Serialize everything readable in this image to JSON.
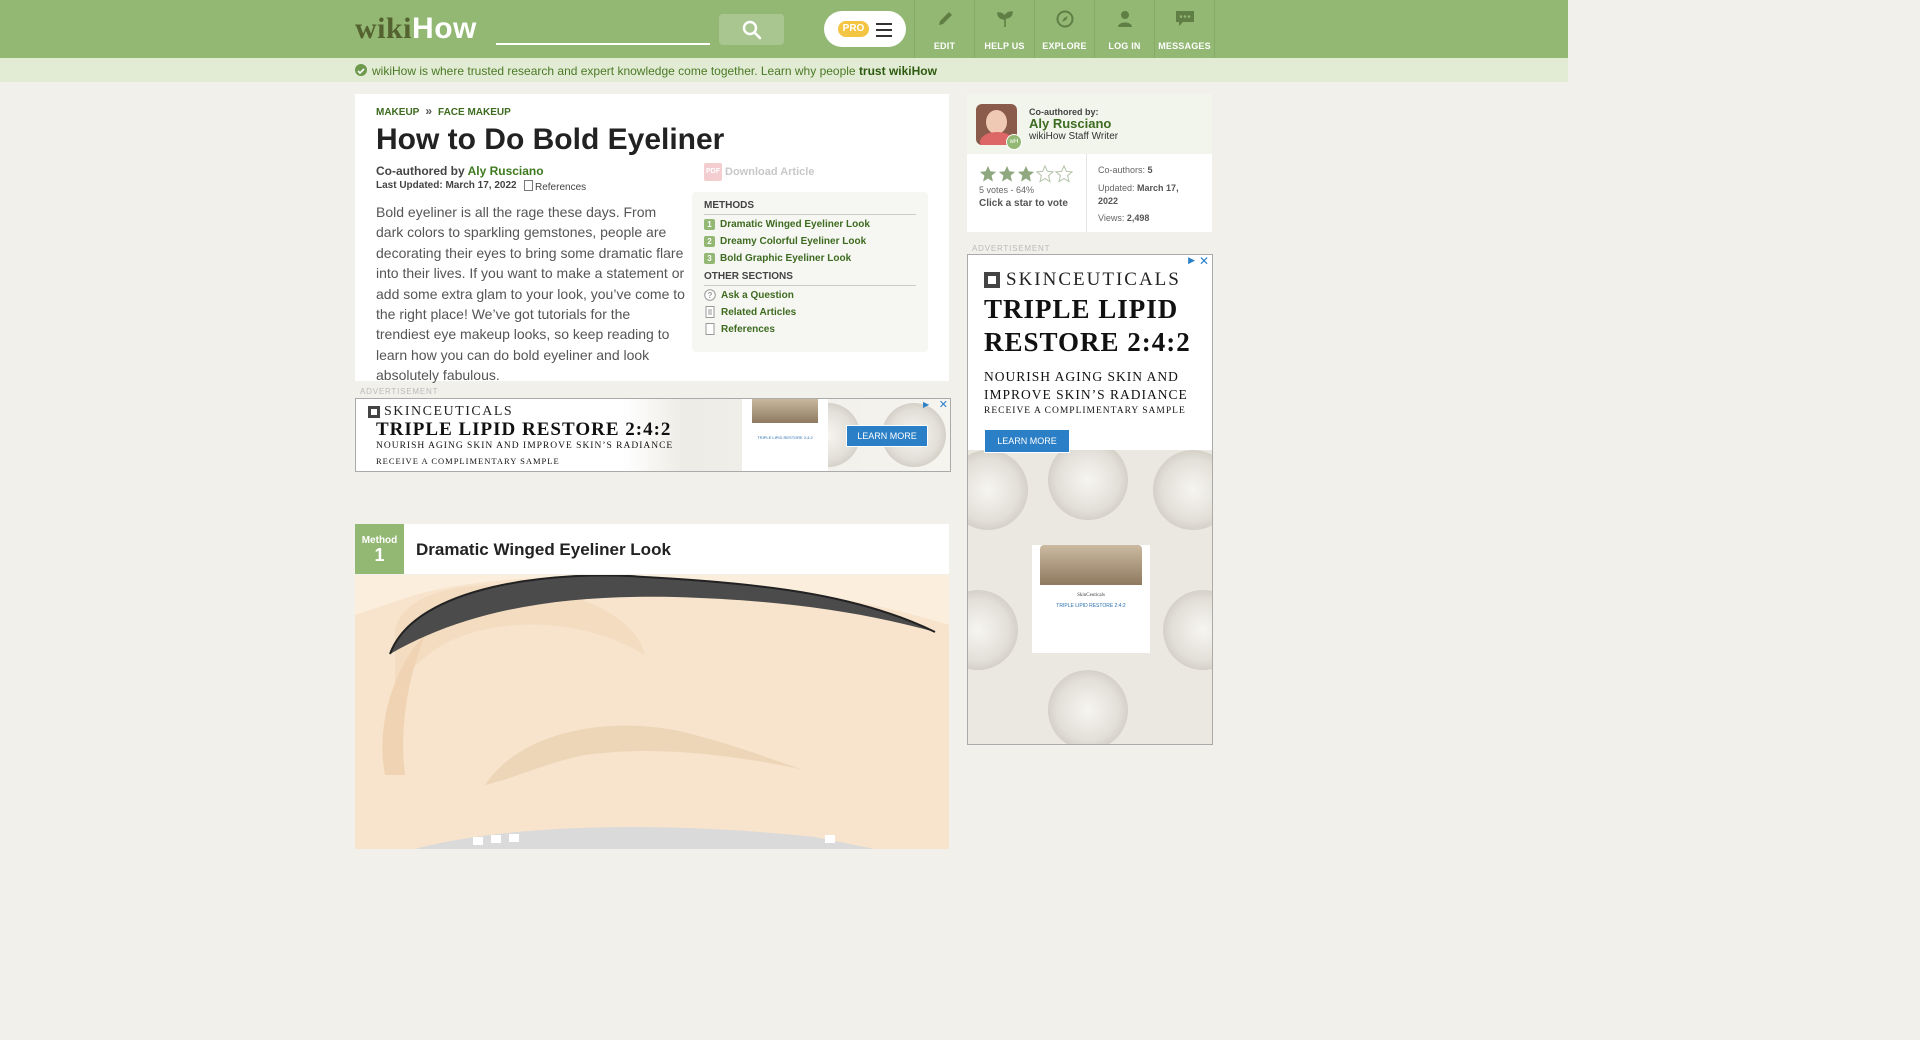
{
  "header": {
    "logo_part1": "wiki",
    "logo_part2": "How",
    "pro_badge": "PRO",
    "nav": [
      {
        "label": "EDIT",
        "icon": "pencil-icon"
      },
      {
        "label": "HELP US",
        "icon": "sprout-icon"
      },
      {
        "label": "EXPLORE",
        "icon": "compass-icon"
      },
      {
        "label": "LOG IN",
        "icon": "user-icon"
      },
      {
        "label": "MESSAGES",
        "icon": "chat-icon"
      }
    ]
  },
  "trust_bar": {
    "text": "wikiHow is where trusted research and expert knowledge come together. Learn why people ",
    "link": "trust wikiHow"
  },
  "article": {
    "breadcrumb": [
      "MAKEUP",
      "FACE MAKEUP"
    ],
    "breadcrumb_sep": "»",
    "title": "How to Do Bold Eyeliner",
    "coauthored_prefix": "Co-authored by",
    "author": "Aly Rusciano",
    "last_updated": "Last Updated: March 17, 2022",
    "references_label": "References",
    "download_label": "Download Article",
    "pdf_label": "PDF",
    "intro": "Bold eyeliner is all the rage these days. From dark colors to sparkling gemstones, people are decorating their eyes to bring some dramatic flare into their lives. If you want to make a statement or add some extra glam to your look, you’ve come to the right place! We’ve got tutorials for the trendiest eye makeup looks, so keep reading to learn how you can do bold eyeliner and look absolutely fabulous."
  },
  "toc": {
    "methods_heading": "METHODS",
    "methods": [
      {
        "num": "1",
        "label": "Dramatic Winged Eyeliner Look"
      },
      {
        "num": "2",
        "label": "Dreamy Colorful Eyeliner Look"
      },
      {
        "num": "3",
        "label": "Bold Graphic Eyeliner Look"
      }
    ],
    "other_heading": "OTHER SECTIONS",
    "other": [
      {
        "label": "Ask a Question",
        "icon": "question-icon"
      },
      {
        "label": "Related Articles",
        "icon": "document-icon"
      },
      {
        "label": "References",
        "icon": "bookmark-icon"
      }
    ]
  },
  "ads": {
    "label": "ADVERTISEMENT",
    "brand": "SKINCEUTICALS",
    "headline": "TRIPLE LIPID RESTORE 2:4:2",
    "sub_banner": "NOURISH AGING SKIN AND IMPROVE SKIN’S RADIANCE",
    "sub_side_1": "NOURISH AGING SKIN AND",
    "sub_side_2": "IMPROVE SKIN’S RADIANCE",
    "cta": "RECEIVE A COMPLIMENTARY SAMPLE",
    "button": "LEARN MORE",
    "close": "✕",
    "jar_label": "TRIPLE LIPID RESTORE 2:4:2",
    "jar_brand": "SkinCeuticals"
  },
  "method_section": {
    "badge_word": "Method",
    "badge_num": "1",
    "title": "Dramatic Winged Eyeliner Look"
  },
  "sidebar": {
    "coauthored_by": "Co-authored by:",
    "author": "Aly Rusciano",
    "role": "wikiHow Staff Writer",
    "rating": {
      "stars_filled": 3,
      "stars_total": 5,
      "summary": "5 votes - 64%",
      "cta": "Click a star to vote"
    },
    "coauthors_label": "Co-authors:",
    "coauthors_value": "5",
    "updated_label": "Updated:",
    "updated_value": "March 17, 2022",
    "views_label": "Views:",
    "views_value": "2,498",
    "avatar_badge": "wH"
  },
  "colors": {
    "header_green": "#93b874",
    "link_green": "#3d6b1f",
    "trust_bg": "#e2ebd4",
    "page_bg": "#f1f0ea",
    "ad_blue": "#2a7fc6",
    "star_filled": "#8fa880"
  }
}
